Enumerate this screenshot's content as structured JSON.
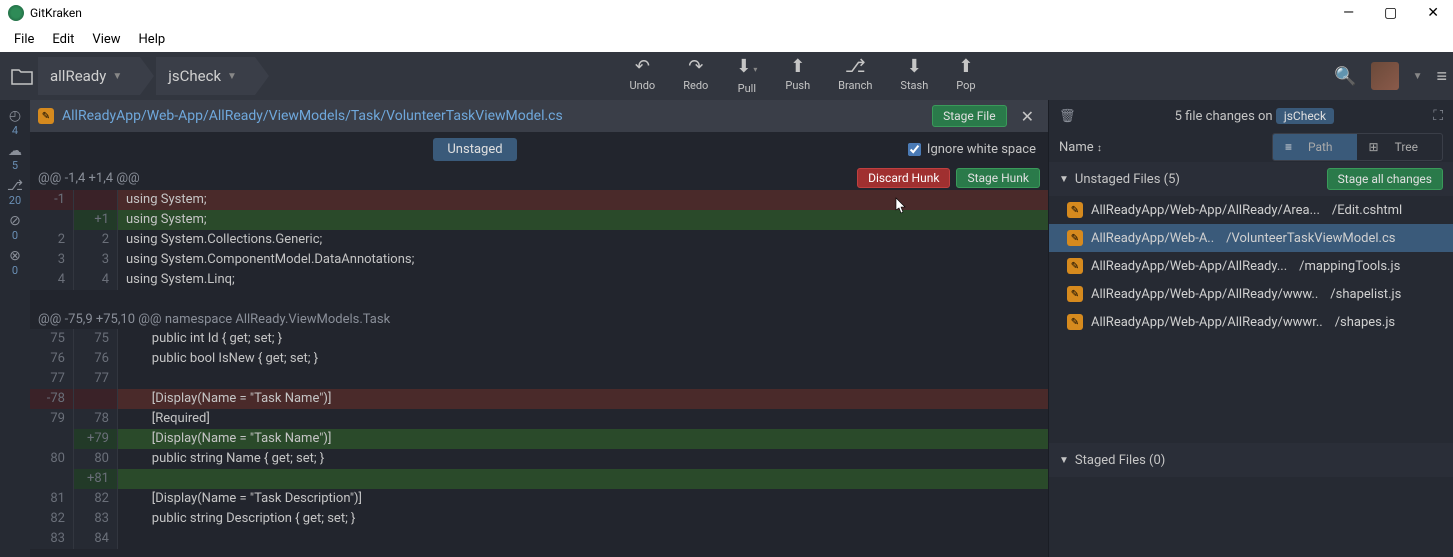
{
  "window": {
    "title": "GitKraken"
  },
  "menu": {
    "file": "File",
    "edit": "Edit",
    "view": "View",
    "help": "Help"
  },
  "toolbar": {
    "undo": "Undo",
    "redo": "Redo",
    "pull": "Pull",
    "push": "Push",
    "branch": "Branch",
    "stash": "Stash",
    "pop": "Pop"
  },
  "crumbs": {
    "repo": "allReady",
    "branch": "jsCheck"
  },
  "rail": [
    {
      "icon": "◴",
      "num": "4"
    },
    {
      "icon": "☁",
      "num": "5"
    },
    {
      "icon": "⎇",
      "num": "20"
    },
    {
      "icon": "⊘",
      "num": "0"
    },
    {
      "icon": "⊗",
      "num": "0"
    }
  ],
  "file": {
    "path": "AllReadyApp/Web-App/AllReady/ViewModels/Task/VolunteerTaskViewModel.cs",
    "stage_file": "Stage File",
    "unstaged_label": "Unstaged",
    "ignore_ws": "Ignore white space",
    "discard_hunk": "Discard Hunk",
    "stage_hunk": "Stage Hunk"
  },
  "diff": {
    "hunk1": "@@ -1,4 +1,4 @@",
    "hunk2": "@@ -75,9 +75,10 @@ namespace AllReady.ViewModels.Task",
    "lines": [
      {
        "old": "-1",
        "new": "",
        "type": "deleted",
        "text": "using System;"
      },
      {
        "old": "",
        "new": "+1",
        "type": "added",
        "text": "using System;"
      },
      {
        "old": "2",
        "new": "2",
        "type": "ctx",
        "text": "using System.Collections.Generic;"
      },
      {
        "old": "3",
        "new": "3",
        "type": "ctx",
        "text": "using System.ComponentModel.DataAnnotations;"
      },
      {
        "old": "4",
        "new": "4",
        "type": "ctx",
        "text": "using System.Linq;"
      }
    ],
    "lines2": [
      {
        "old": "75",
        "new": "75",
        "type": "ctx",
        "text": "        public int Id { get; set; }"
      },
      {
        "old": "76",
        "new": "76",
        "type": "ctx",
        "text": "        public bool IsNew { get; set; }"
      },
      {
        "old": "77",
        "new": "77",
        "type": "ctx",
        "text": ""
      },
      {
        "old": "-78",
        "new": "",
        "type": "deleted",
        "text": "        [Display(Name = \"Task Name\")]"
      },
      {
        "old": "79",
        "new": "78",
        "type": "ctx",
        "text": "        [Required]"
      },
      {
        "old": "",
        "new": "+79",
        "type": "added",
        "text": "        [Display(Name = \"Task Name\")]"
      },
      {
        "old": "80",
        "new": "80",
        "type": "ctx",
        "text": "        public string Name { get; set; }"
      },
      {
        "old": "",
        "new": "+81",
        "type": "added",
        "text": ""
      },
      {
        "old": "81",
        "new": "82",
        "type": "ctx",
        "text": "        [Display(Name = \"Task Description\")]"
      },
      {
        "old": "82",
        "new": "83",
        "type": "ctx",
        "text": "        public string Description { get; set; }"
      },
      {
        "old": "83",
        "new": "84",
        "type": "ctx",
        "text": ""
      }
    ]
  },
  "sidebar": {
    "changes_text": "5 file changes on",
    "branch": "jsCheck",
    "name_label": "Name",
    "path_label": "Path",
    "tree_label": "Tree",
    "unstaged_header": "Unstaged Files (5)",
    "stage_all": "Stage all changes",
    "staged_header": "Staged Files (0)",
    "files": [
      {
        "a": "AllReadyApp/Web-App/AllReady/Area...",
        "b": "/Edit.cshtml",
        "sel": false
      },
      {
        "a": "AllReadyApp/Web-A..",
        "b": "/VolunteerTaskViewModel.cs",
        "sel": true
      },
      {
        "a": "AllReadyApp/Web-App/AllReady...",
        "b": "/mappingTools.js",
        "sel": false
      },
      {
        "a": "AllReadyApp/Web-App/AllReady/www..",
        "b": "/shapelist.js",
        "sel": false
      },
      {
        "a": "AllReadyApp/Web-App/AllReady/wwwr..",
        "b": "/shapes.js",
        "sel": false
      }
    ]
  }
}
